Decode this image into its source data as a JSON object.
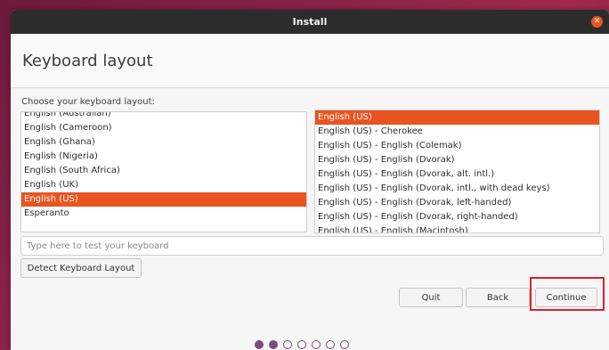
{
  "window": {
    "title": "Install"
  },
  "header": {
    "title": "Keyboard layout"
  },
  "prompt": "Choose your keyboard layout:",
  "layouts": [
    {
      "label": "English (Australian)",
      "selected": false
    },
    {
      "label": "English (Cameroon)",
      "selected": false
    },
    {
      "label": "English (Ghana)",
      "selected": false
    },
    {
      "label": "English (Nigeria)",
      "selected": false
    },
    {
      "label": "English (South Africa)",
      "selected": false
    },
    {
      "label": "English (UK)",
      "selected": false
    },
    {
      "label": "English (US)",
      "selected": true
    },
    {
      "label": "Esperanto",
      "selected": false
    }
  ],
  "variants": [
    {
      "label": "English (US)",
      "selected": true
    },
    {
      "label": "English (US) - Cherokee",
      "selected": false
    },
    {
      "label": "English (US) - English (Colemak)",
      "selected": false
    },
    {
      "label": "English (US) - English (Dvorak)",
      "selected": false
    },
    {
      "label": "English (US) - English (Dvorak, alt. intl.)",
      "selected": false
    },
    {
      "label": "English (US) - English (Dvorak, intl., with dead keys)",
      "selected": false
    },
    {
      "label": "English (US) - English (Dvorak, left-handed)",
      "selected": false
    },
    {
      "label": "English (US) - English (Dvorak, right-handed)",
      "selected": false
    },
    {
      "label": "English (US) - English (Macintosh)",
      "selected": false
    }
  ],
  "test_input": {
    "placeholder": "Type here to test your keyboard",
    "value": ""
  },
  "buttons": {
    "detect": "Detect Keyboard Layout",
    "quit": "Quit",
    "back": "Back",
    "continue": "Continue"
  },
  "progress": {
    "total_steps": 7,
    "current_step": 2
  },
  "colors": {
    "accent": "#e95420",
    "highlight_box": "#e0202a",
    "progress_dot": "#7d4b7d"
  }
}
